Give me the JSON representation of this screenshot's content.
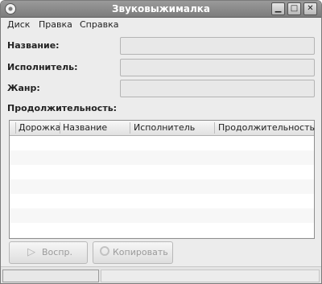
{
  "window": {
    "title": "Звуковыжималка",
    "controls": [
      "minimize-icon",
      "maximize-icon",
      "close-icon"
    ]
  },
  "menu": [
    {
      "key": "disk",
      "label": "Диск"
    },
    {
      "key": "edit",
      "label": "Правка"
    },
    {
      "key": "help",
      "label": "Справка"
    }
  ],
  "form": {
    "title_label": "Название:",
    "artist_label": "Исполнитель:",
    "genre_label": "Жанр:",
    "duration_label": "Продолжительность:",
    "title_value": "",
    "artist_value": "",
    "genre_value": ""
  },
  "tracks": {
    "columns": [
      "Дорожка",
      "Название",
      "Исполнитель",
      "Продолжительность"
    ],
    "rows": []
  },
  "buttons": {
    "play_label": "Воспр.",
    "copy_label": "Копировать",
    "enabled": false
  },
  "status": {
    "progress": 0,
    "text": ""
  }
}
